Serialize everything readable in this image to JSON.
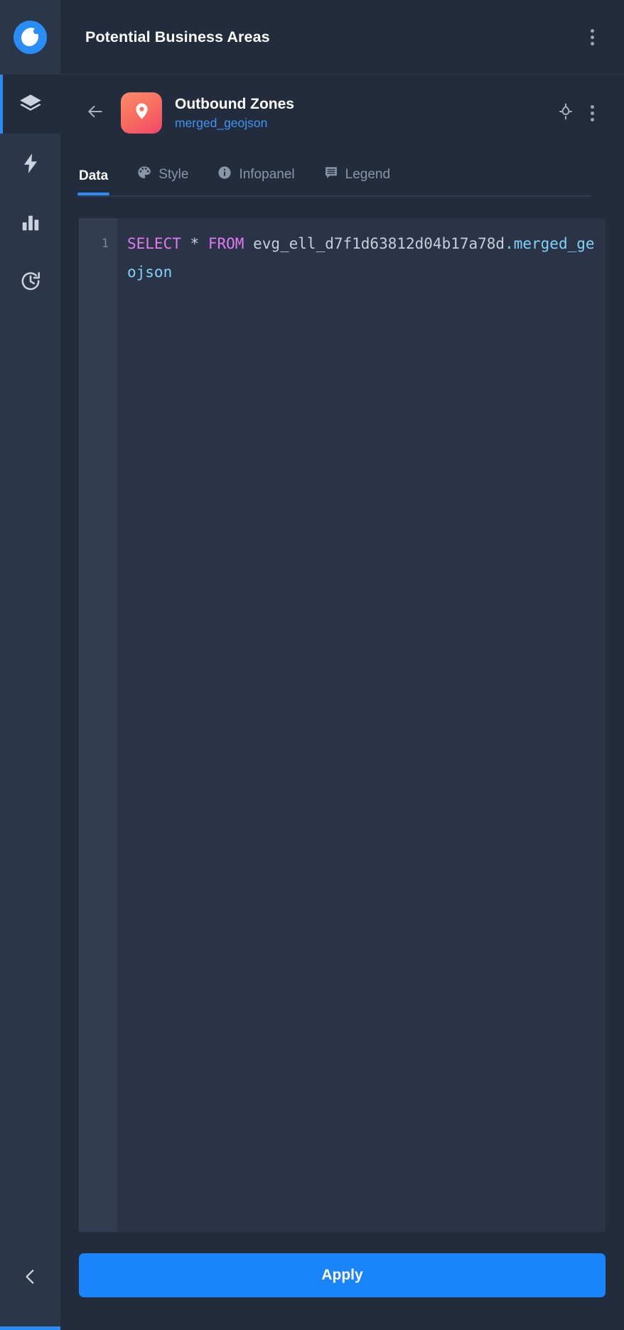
{
  "brand": {
    "logo_icon": "cloud-blob-logo-icon",
    "accent_color": "#2a8cf5"
  },
  "sidebar": {
    "items": [
      {
        "icon": "layers-icon",
        "name": "layers",
        "active": true
      },
      {
        "icon": "lightning-icon",
        "name": "lightning",
        "active": false
      },
      {
        "icon": "bar-chart-icon",
        "name": "analytics",
        "active": false
      },
      {
        "icon": "history-clock-icon",
        "name": "history",
        "active": false
      }
    ],
    "collapse_icon": "chevron-left-icon"
  },
  "header": {
    "title": "Potential Business Areas",
    "menu_icon": "kebab-menu-icon"
  },
  "layer": {
    "back_icon": "arrow-left-icon",
    "pin_icon": "map-pin-icon",
    "title": "Outbound Zones",
    "subtitle": "merged_geojson",
    "locate_icon": "crosshair-target-icon",
    "menu_icon": "kebab-menu-icon",
    "icon_gradient_from": "#fb8a6b",
    "icon_gradient_to": "#f1476a",
    "subtitle_color": "#3e93f2"
  },
  "tabs": [
    {
      "label": "Data",
      "icon": null,
      "active": true
    },
    {
      "label": "Style",
      "icon": "palette-icon",
      "active": false
    },
    {
      "label": "Infopanel",
      "icon": "info-circle-icon",
      "active": false
    },
    {
      "label": "Legend",
      "icon": "legend-list-icon",
      "active": false
    }
  ],
  "editor": {
    "line_number": "1",
    "query": {
      "keyword_select": "SELECT",
      "star": "*",
      "keyword_from": "FROM",
      "schema": "evg_ell_d7f1d63812d04b17a78d",
      "dot": ".",
      "table": "merged_geojson"
    },
    "keyword_color": "#e07af0",
    "table_color": "#7fd3f7"
  },
  "footer": {
    "apply_label": "Apply",
    "apply_color": "#1a85fb"
  }
}
